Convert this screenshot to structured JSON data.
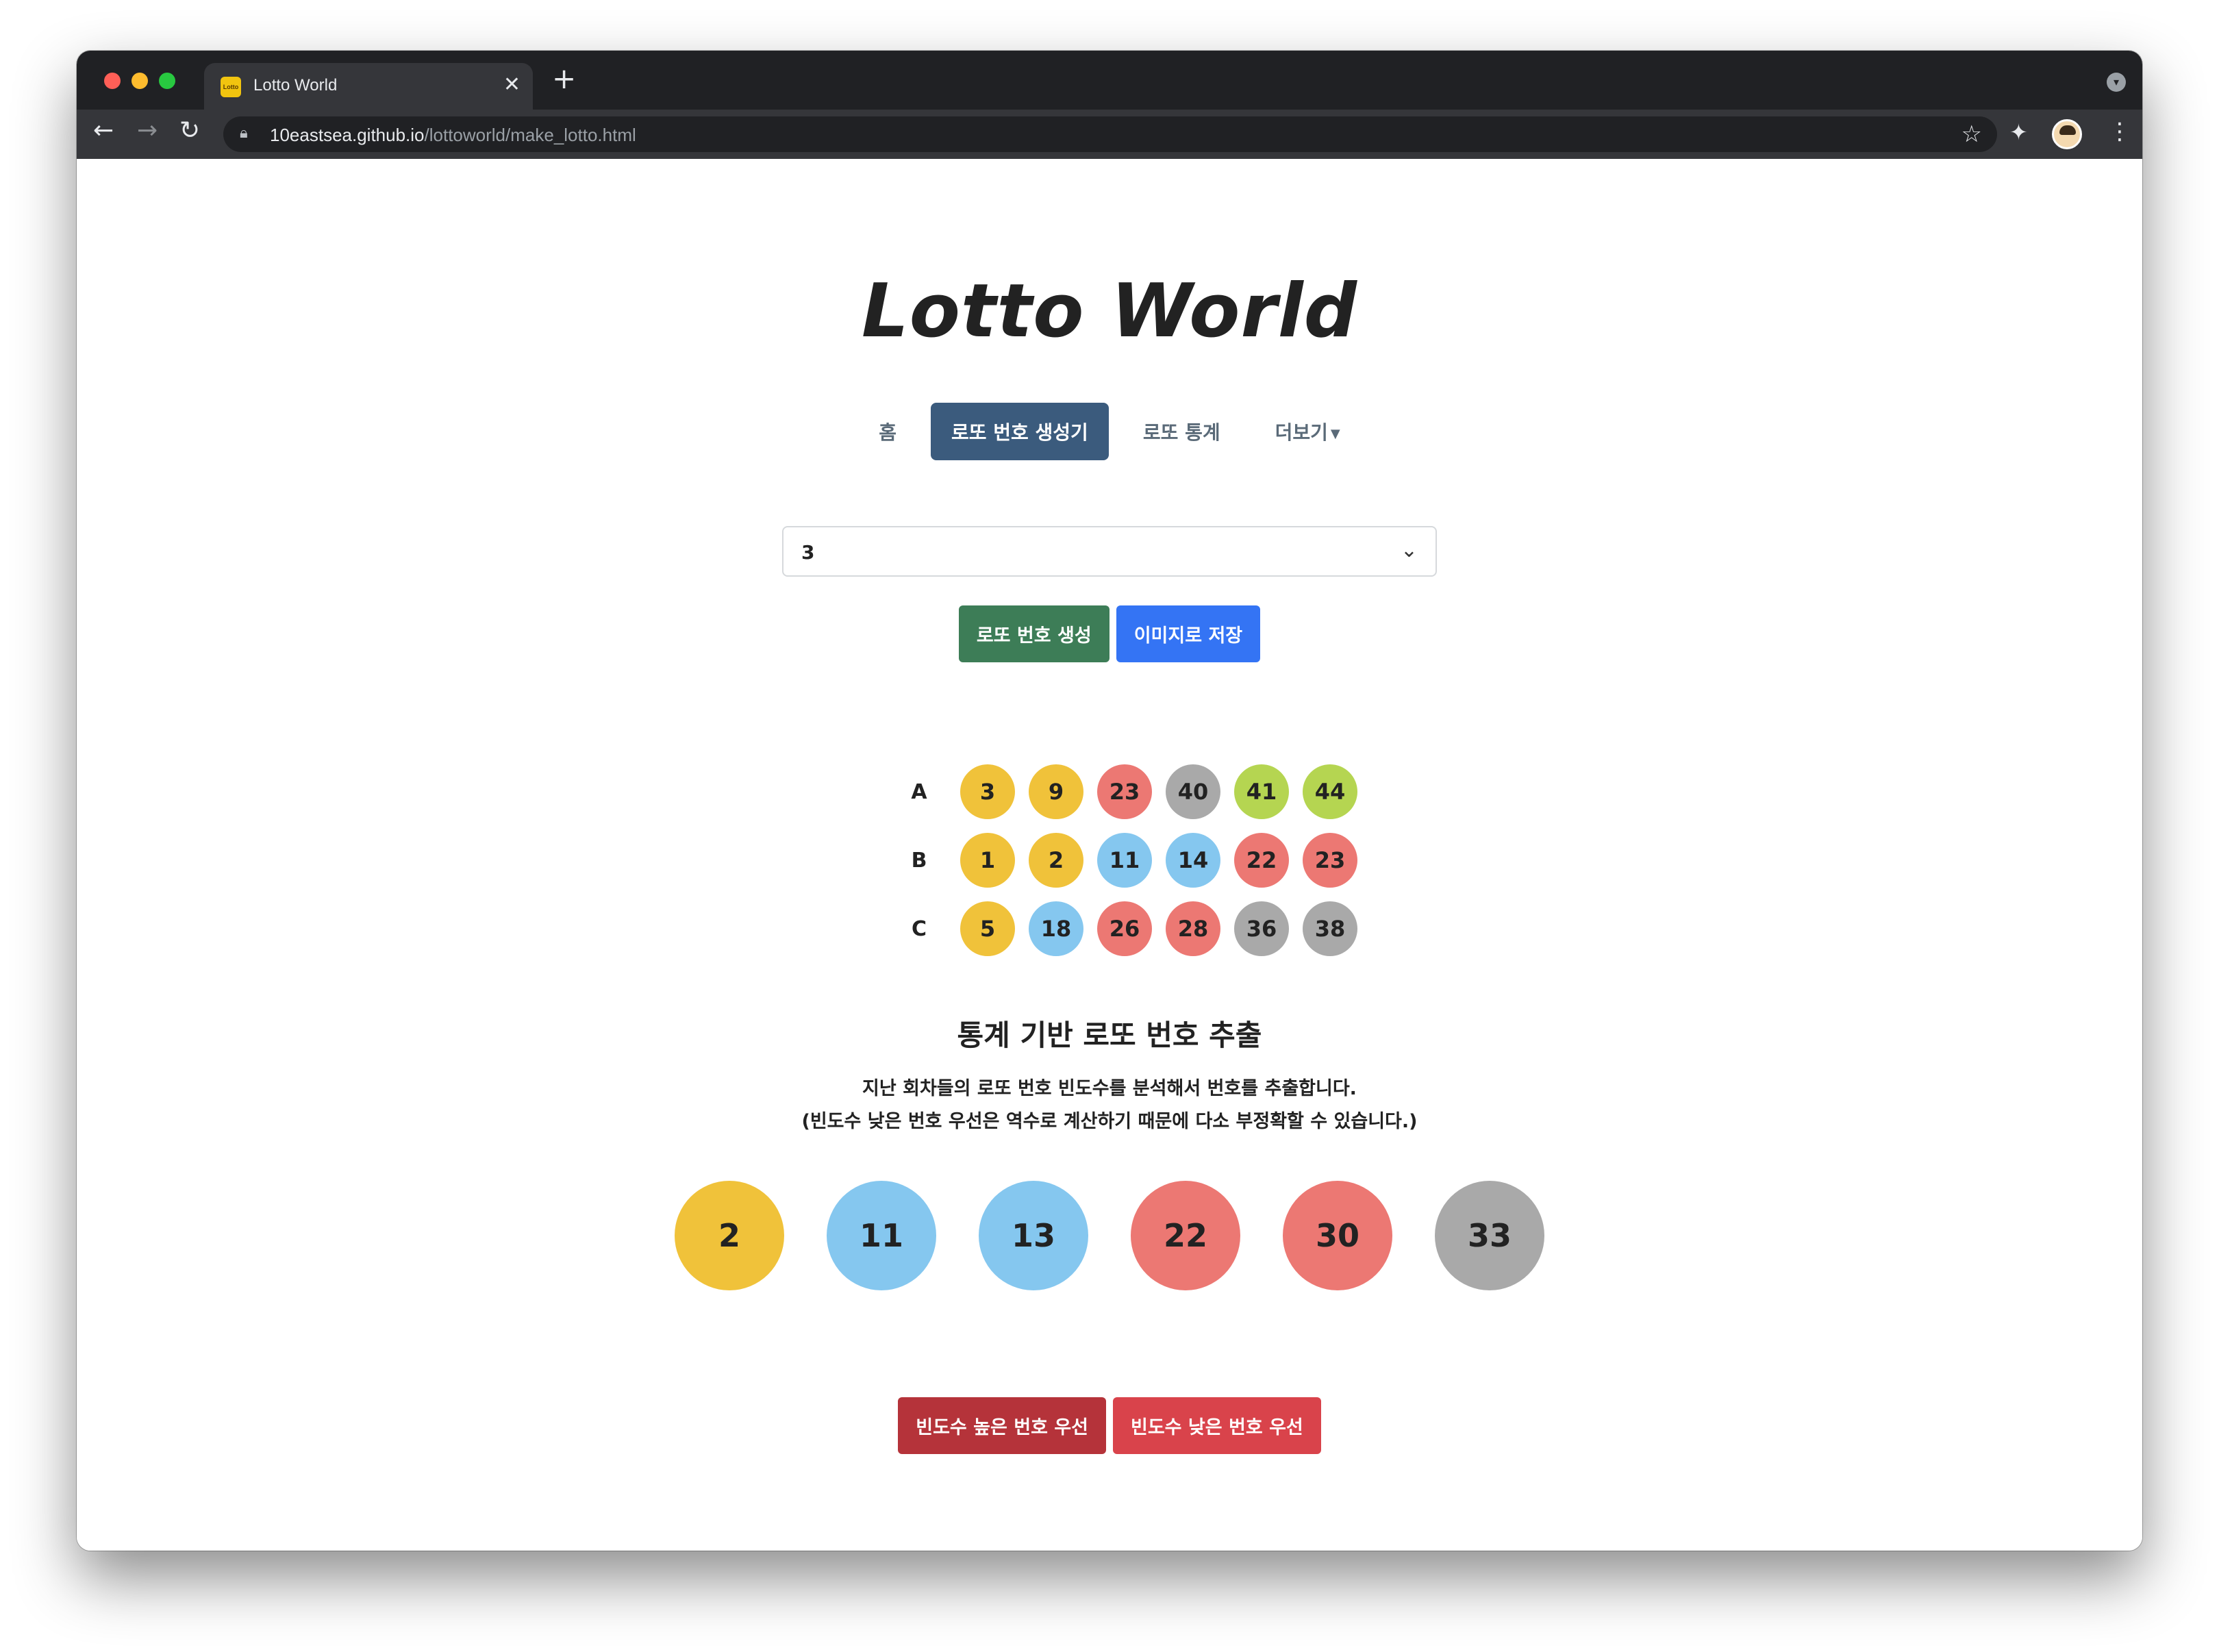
{
  "browser": {
    "tab_title": "Lotto World",
    "tab_favicon_text": "Lotto",
    "url_host": "10eastsea.github.io",
    "url_path": "/lottoworld/make_lotto.html"
  },
  "site": {
    "logo": "Lotto World",
    "nav": [
      {
        "label": "홈"
      },
      {
        "label": "로또 번호 생성기"
      },
      {
        "label": "로또 통계"
      },
      {
        "label": "더보기"
      }
    ]
  },
  "generator": {
    "count_value": "3",
    "generate_label": "로또 번호 생성",
    "save_label": "이미지로 저장",
    "rows": [
      {
        "label": "A",
        "numbers": [
          "3",
          "9",
          "23",
          "40",
          "41",
          "44"
        ]
      },
      {
        "label": "B",
        "numbers": [
          "1",
          "2",
          "11",
          "14",
          "22",
          "23"
        ]
      },
      {
        "label": "C",
        "numbers": [
          "5",
          "18",
          "26",
          "28",
          "36",
          "38"
        ]
      }
    ]
  },
  "stats": {
    "title": "통계 기반 로또 번호 추출",
    "desc_line1": "지난 회차들의 로또 번호 빈도수를 분석해서 번호를 추출합니다.",
    "desc_line2": "(빈도수 낮은 번호 우선은 역수로 계산하기 때문에 다소 부정확할 수 있습니다.)",
    "numbers": [
      "2",
      "11",
      "13",
      "22",
      "30",
      "33"
    ],
    "high_label": "빈도수 높은 번호 우선",
    "low_label": "빈도수 낮은 번호 우선"
  },
  "ball_colors": {
    "1-10": "#f0c23a",
    "11-20": "#85c7ef",
    "21-30": "#ec7873",
    "31-40": "#a9a9a9",
    "41-45": "#b5d551"
  }
}
